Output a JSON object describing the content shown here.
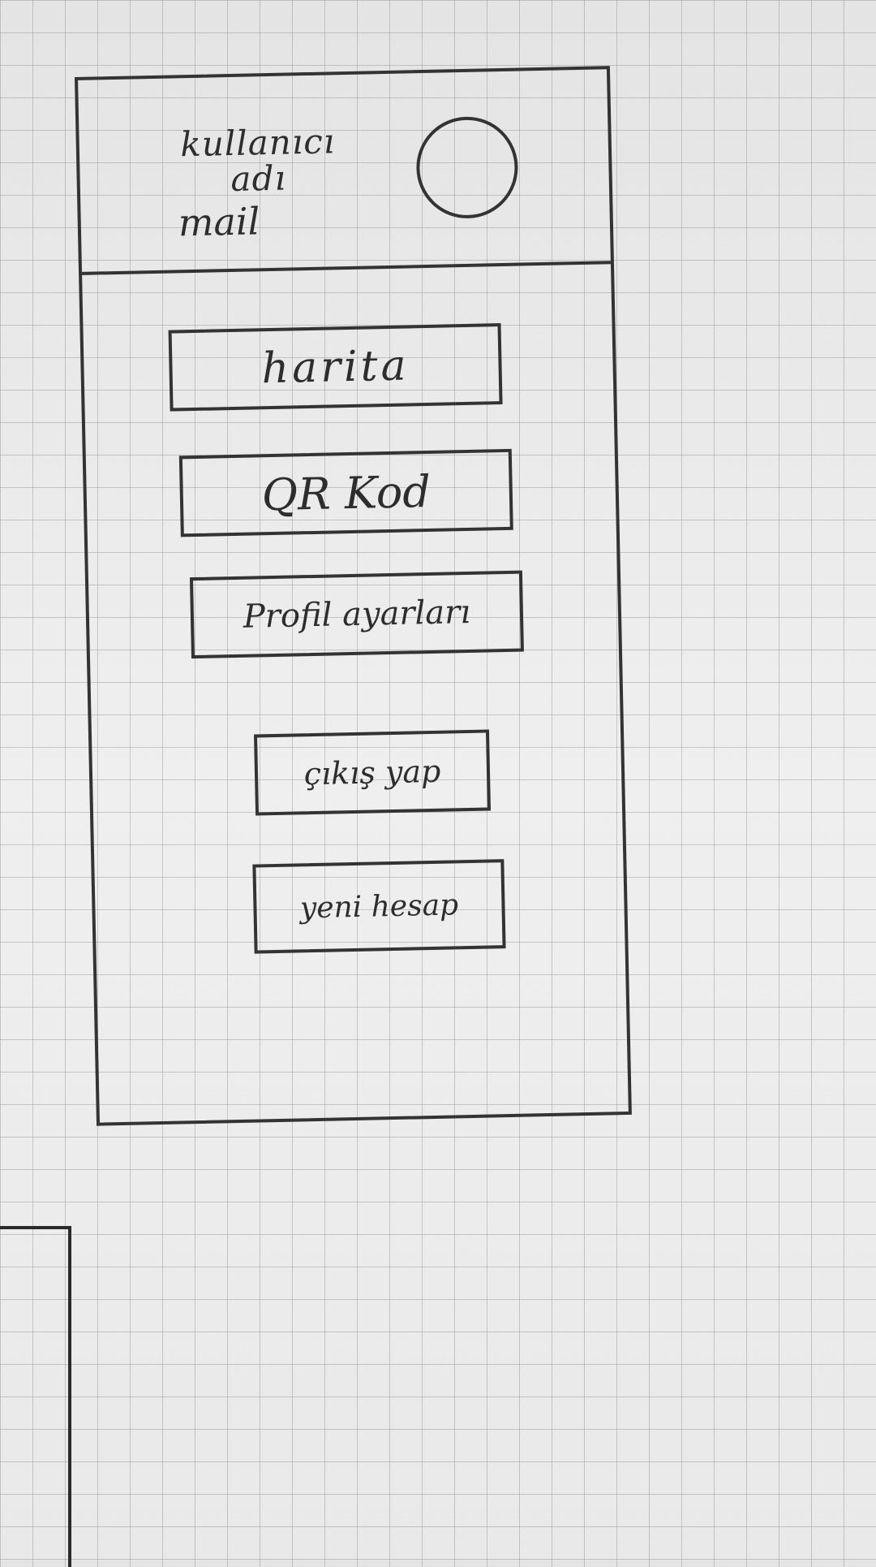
{
  "header": {
    "username": "kullanıcı adı",
    "email": "mail"
  },
  "menu": {
    "map_label": "harita",
    "qr_label": "QR Kod",
    "profile_settings_label": "Profil ayarları"
  },
  "auth": {
    "logout_label": "çıkış yap",
    "new_account_label": "yeni hesap"
  }
}
